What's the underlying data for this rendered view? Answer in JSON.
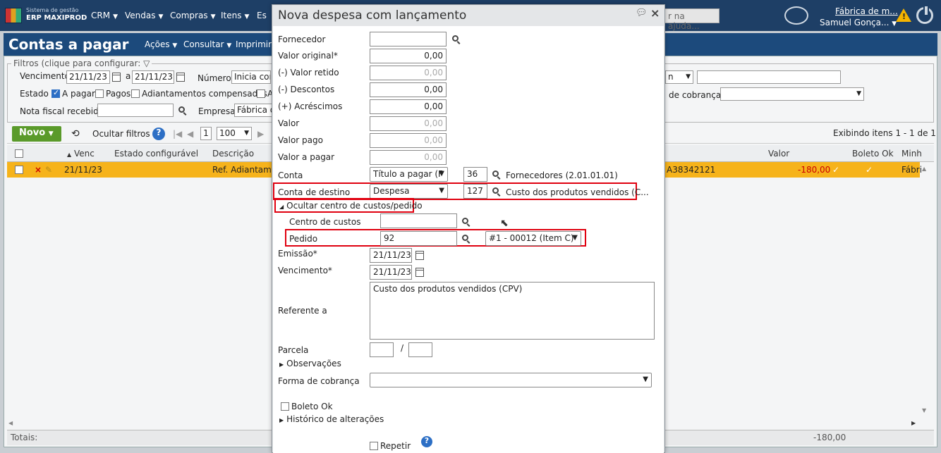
{
  "app": {
    "logo_line1": "Sistema de gestão",
    "logo_line2": "ERP MAXIPROD",
    "menu": [
      "CRM",
      "Vendas",
      "Compras",
      "Itens",
      "Es"
    ],
    "help_placeholder": "r na ajuda...",
    "company": "Fábrica de m...",
    "user": "Samuel Gonça...",
    "warning_symbol": "!"
  },
  "page": {
    "title": "Contas a pagar",
    "menu": [
      "Ações",
      "Consultar",
      "Imprimir"
    ]
  },
  "filters": {
    "legend": "Filtros (clique para configurar:",
    "vencimento_label": "Vencimento",
    "venc_from": "21/11/23",
    "venc_sep": "a",
    "venc_to": "21/11/23",
    "numero_label": "Número",
    "numero_value": "Inicia con",
    "estado_label": "Estado",
    "apagar_label": "A pagar",
    "pagos_label": "Pagos",
    "adiant_label": "Adiantamentos compensados",
    "a_label": "A",
    "nf_label": "Nota fiscal recebida",
    "empresa_label": "Empresa",
    "empresa_value": "Fábrica d",
    "cobranca_label": "de cobrança",
    "right_select": "n"
  },
  "toolbar": {
    "novo": "Novo",
    "ocultar": "Ocultar filtros",
    "page_num": "1",
    "page_size": "100",
    "exibindo": "Exibindo itens 1 - 1 de 1"
  },
  "grid": {
    "headers": {
      "venc": "Venc",
      "estado": "Estado configurável",
      "descricao": "Descrição",
      "valor": "Valor",
      "boleto": "Boleto Ok",
      "minh": "Minh"
    },
    "row": {
      "venc": "21/11/23",
      "descricao": "Ref. Adiantame",
      "codigo": "A38342121",
      "valor": "-180,00",
      "fab": "Fábri"
    },
    "totals_label": "Totais:",
    "totals_value": "-180,00"
  },
  "modal": {
    "title": "Nova despesa com lançamento",
    "fornecedor_label": "Fornecedor",
    "fornecedor_value": "",
    "valor_original_label": "Valor original*",
    "valor_original": "0,00",
    "valor_retido_label": "(-) Valor retido",
    "valor_retido": "0,00",
    "descontos_label": "(-) Descontos",
    "descontos": "0,00",
    "acrescimos_label": "(+) Acréscimos",
    "acrescimos": "0,00",
    "valor_label": "Valor",
    "valor": "0,00",
    "valor_pago_label": "Valor pago",
    "valor_pago": "0,00",
    "valor_a_pagar_label": "Valor a pagar",
    "valor_a_pagar": "0,00",
    "conta_label": "Conta",
    "conta_select": "Título a pagar (F",
    "conta_code": "36",
    "conta_desc": "Fornecedores (2.01.01.01)",
    "conta_destino_label": "Conta de destino",
    "conta_destino_select": "Despesa",
    "conta_destino_code": "127",
    "conta_destino_desc": "Custo dos produtos vendidos (C...",
    "ocultar_centro": "Ocultar centro de custos/pedido",
    "centro_label": "Centro de custos",
    "centro_value": "",
    "pedido_label": "Pedido",
    "pedido_value": "92",
    "pedido_item": "#1 - 00012 (Item C)",
    "emissao_label": "Emissão*",
    "emissao": "21/11/23",
    "vencimento_label": "Vencimento*",
    "vencimento": "21/11/23",
    "referente_label": "Referente a",
    "referente": "Custo dos produtos vendidos (CPV)",
    "parcela_label": "Parcela",
    "parcela_sep": "/",
    "observacoes": "Observações",
    "forma_label": "Forma de cobrança",
    "forma_value": "",
    "boleto_label": "Boleto Ok",
    "historico": "Histórico de alterações",
    "repetir_label": "Repetir"
  },
  "colors": {
    "header_bg": "#1e3f66",
    "row_highlight": "#f6b31b",
    "novo_green": "#5a9a2a",
    "annotation_red": "#e0000f"
  }
}
